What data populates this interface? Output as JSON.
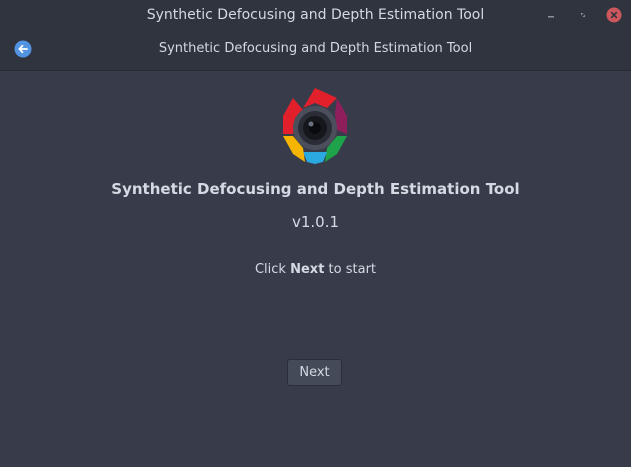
{
  "window": {
    "title": "Synthetic Defocusing and Depth Estimation Tool",
    "controls": [
      "minimize",
      "maximize",
      "close"
    ]
  },
  "header": {
    "title": "Synthetic Defocusing and Depth Estimation Tool",
    "back_icon": "back-arrow-icon"
  },
  "main": {
    "app_name": "Synthetic Defocusing and Depth Estimation Tool",
    "version": "v1.0.1",
    "instruction_prefix": "Click",
    "instruction_emphasis": "Next",
    "instruction_suffix": "to start",
    "next_label": "Next",
    "logo_icon": "camera-aperture-logo"
  },
  "colors": {
    "window_bg": "#383c4a",
    "titlebar_bg": "#2f343f",
    "text": "#d3dae3",
    "accent_blue": "#5294e2",
    "close_red": "#cc575d",
    "logo_red": "#e2202b",
    "logo_purple": "#8e1f5c",
    "logo_green": "#1fa34a",
    "logo_blue": "#2aa9e0",
    "logo_yellow": "#f5b400"
  }
}
